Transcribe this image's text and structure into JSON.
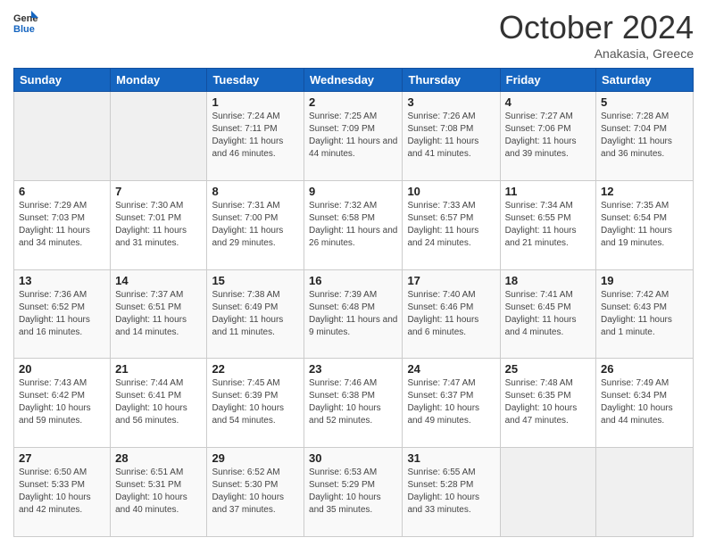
{
  "header": {
    "logo_general": "General",
    "logo_blue": "Blue",
    "month_title": "October 2024",
    "subtitle": "Anakasia, Greece"
  },
  "days_of_week": [
    "Sunday",
    "Monday",
    "Tuesday",
    "Wednesday",
    "Thursday",
    "Friday",
    "Saturday"
  ],
  "weeks": [
    [
      {
        "day": "",
        "sunrise": "",
        "sunset": "",
        "daylight": ""
      },
      {
        "day": "",
        "sunrise": "",
        "sunset": "",
        "daylight": ""
      },
      {
        "day": "1",
        "sunrise": "Sunrise: 7:24 AM",
        "sunset": "Sunset: 7:11 PM",
        "daylight": "Daylight: 11 hours and 46 minutes."
      },
      {
        "day": "2",
        "sunrise": "Sunrise: 7:25 AM",
        "sunset": "Sunset: 7:09 PM",
        "daylight": "Daylight: 11 hours and 44 minutes."
      },
      {
        "day": "3",
        "sunrise": "Sunrise: 7:26 AM",
        "sunset": "Sunset: 7:08 PM",
        "daylight": "Daylight: 11 hours and 41 minutes."
      },
      {
        "day": "4",
        "sunrise": "Sunrise: 7:27 AM",
        "sunset": "Sunset: 7:06 PM",
        "daylight": "Daylight: 11 hours and 39 minutes."
      },
      {
        "day": "5",
        "sunrise": "Sunrise: 7:28 AM",
        "sunset": "Sunset: 7:04 PM",
        "daylight": "Daylight: 11 hours and 36 minutes."
      }
    ],
    [
      {
        "day": "6",
        "sunrise": "Sunrise: 7:29 AM",
        "sunset": "Sunset: 7:03 PM",
        "daylight": "Daylight: 11 hours and 34 minutes."
      },
      {
        "day": "7",
        "sunrise": "Sunrise: 7:30 AM",
        "sunset": "Sunset: 7:01 PM",
        "daylight": "Daylight: 11 hours and 31 minutes."
      },
      {
        "day": "8",
        "sunrise": "Sunrise: 7:31 AM",
        "sunset": "Sunset: 7:00 PM",
        "daylight": "Daylight: 11 hours and 29 minutes."
      },
      {
        "day": "9",
        "sunrise": "Sunrise: 7:32 AM",
        "sunset": "Sunset: 6:58 PM",
        "daylight": "Daylight: 11 hours and 26 minutes."
      },
      {
        "day": "10",
        "sunrise": "Sunrise: 7:33 AM",
        "sunset": "Sunset: 6:57 PM",
        "daylight": "Daylight: 11 hours and 24 minutes."
      },
      {
        "day": "11",
        "sunrise": "Sunrise: 7:34 AM",
        "sunset": "Sunset: 6:55 PM",
        "daylight": "Daylight: 11 hours and 21 minutes."
      },
      {
        "day": "12",
        "sunrise": "Sunrise: 7:35 AM",
        "sunset": "Sunset: 6:54 PM",
        "daylight": "Daylight: 11 hours and 19 minutes."
      }
    ],
    [
      {
        "day": "13",
        "sunrise": "Sunrise: 7:36 AM",
        "sunset": "Sunset: 6:52 PM",
        "daylight": "Daylight: 11 hours and 16 minutes."
      },
      {
        "day": "14",
        "sunrise": "Sunrise: 7:37 AM",
        "sunset": "Sunset: 6:51 PM",
        "daylight": "Daylight: 11 hours and 14 minutes."
      },
      {
        "day": "15",
        "sunrise": "Sunrise: 7:38 AM",
        "sunset": "Sunset: 6:49 PM",
        "daylight": "Daylight: 11 hours and 11 minutes."
      },
      {
        "day": "16",
        "sunrise": "Sunrise: 7:39 AM",
        "sunset": "Sunset: 6:48 PM",
        "daylight": "Daylight: 11 hours and 9 minutes."
      },
      {
        "day": "17",
        "sunrise": "Sunrise: 7:40 AM",
        "sunset": "Sunset: 6:46 PM",
        "daylight": "Daylight: 11 hours and 6 minutes."
      },
      {
        "day": "18",
        "sunrise": "Sunrise: 7:41 AM",
        "sunset": "Sunset: 6:45 PM",
        "daylight": "Daylight: 11 hours and 4 minutes."
      },
      {
        "day": "19",
        "sunrise": "Sunrise: 7:42 AM",
        "sunset": "Sunset: 6:43 PM",
        "daylight": "Daylight: 11 hours and 1 minute."
      }
    ],
    [
      {
        "day": "20",
        "sunrise": "Sunrise: 7:43 AM",
        "sunset": "Sunset: 6:42 PM",
        "daylight": "Daylight: 10 hours and 59 minutes."
      },
      {
        "day": "21",
        "sunrise": "Sunrise: 7:44 AM",
        "sunset": "Sunset: 6:41 PM",
        "daylight": "Daylight: 10 hours and 56 minutes."
      },
      {
        "day": "22",
        "sunrise": "Sunrise: 7:45 AM",
        "sunset": "Sunset: 6:39 PM",
        "daylight": "Daylight: 10 hours and 54 minutes."
      },
      {
        "day": "23",
        "sunrise": "Sunrise: 7:46 AM",
        "sunset": "Sunset: 6:38 PM",
        "daylight": "Daylight: 10 hours and 52 minutes."
      },
      {
        "day": "24",
        "sunrise": "Sunrise: 7:47 AM",
        "sunset": "Sunset: 6:37 PM",
        "daylight": "Daylight: 10 hours and 49 minutes."
      },
      {
        "day": "25",
        "sunrise": "Sunrise: 7:48 AM",
        "sunset": "Sunset: 6:35 PM",
        "daylight": "Daylight: 10 hours and 47 minutes."
      },
      {
        "day": "26",
        "sunrise": "Sunrise: 7:49 AM",
        "sunset": "Sunset: 6:34 PM",
        "daylight": "Daylight: 10 hours and 44 minutes."
      }
    ],
    [
      {
        "day": "27",
        "sunrise": "Sunrise: 6:50 AM",
        "sunset": "Sunset: 5:33 PM",
        "daylight": "Daylight: 10 hours and 42 minutes."
      },
      {
        "day": "28",
        "sunrise": "Sunrise: 6:51 AM",
        "sunset": "Sunset: 5:31 PM",
        "daylight": "Daylight: 10 hours and 40 minutes."
      },
      {
        "day": "29",
        "sunrise": "Sunrise: 6:52 AM",
        "sunset": "Sunset: 5:30 PM",
        "daylight": "Daylight: 10 hours and 37 minutes."
      },
      {
        "day": "30",
        "sunrise": "Sunrise: 6:53 AM",
        "sunset": "Sunset: 5:29 PM",
        "daylight": "Daylight: 10 hours and 35 minutes."
      },
      {
        "day": "31",
        "sunrise": "Sunrise: 6:55 AM",
        "sunset": "Sunset: 5:28 PM",
        "daylight": "Daylight: 10 hours and 33 minutes."
      },
      {
        "day": "",
        "sunrise": "",
        "sunset": "",
        "daylight": ""
      },
      {
        "day": "",
        "sunrise": "",
        "sunset": "",
        "daylight": ""
      }
    ]
  ]
}
